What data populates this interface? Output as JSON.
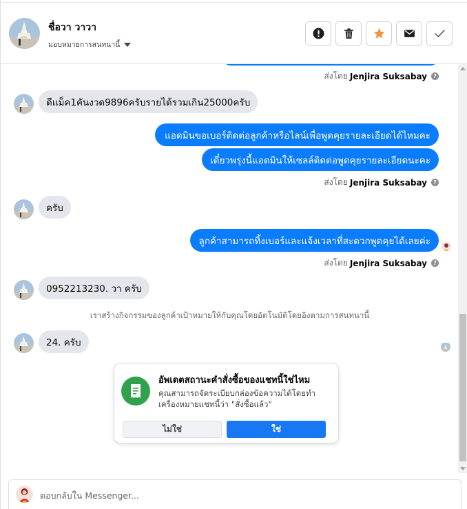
{
  "header": {
    "contact_name": "ชื่อวา วาวา",
    "assign_label": "มอบหมายการสนทนานี้"
  },
  "messages": {
    "sent_by_prefix": "ส่งโดย",
    "sent_by_name": "Jenjira Suksabay",
    "in_1": "ดีแม็ค1คันงวด9896ครับรายได้รวมเกิน25000ครับ",
    "out_1": "แอดมินขอเบอร์ติดต่อลูกค้าหรือไลน์เพื่อพูดคุยรายละเอียดได้ไหมคะ",
    "out_2": "เดี๋ยวพรุ่งนี้แอดมินให้เซลล์ติดต่อพูดคุยรายละเอียดนะคะ",
    "in_2": "ครับ",
    "out_3": "ลูกค้าสามารถทิ้งเบอร์และแจ้งเวลาที่สะดวกพูดคุยได้เลยค่ะ",
    "in_3": "0952213230. วา ครับ",
    "system_note": "เราสร้างกิจกรรมของลูกค้าเป้าหมายให้กับคุณโดยอัตโนมัติโดยอิงตามการสนทนานี้",
    "in_4": "24. ครับ"
  },
  "order_card": {
    "title": "อัพเดตสถานะคำสั่งซื้อของแชทนี้ใช่ไหม",
    "description": "คุณสามารถจัดระเบียบกล่องข้อความได้โดยทำเครื่องหมายแชทนี้ว่า \"สั่งซื้อแล้ว\"",
    "no_label": "ไม่ใช่",
    "yes_label": "ใช่"
  },
  "reply": {
    "placeholder": "ตอบกลับใน Messenger..."
  },
  "icons": {
    "spam": "exclamation-circle-icon",
    "delete": "trash-icon",
    "star": "star-icon",
    "unread": "envelope-icon",
    "done": "checkmark-icon",
    "help": "question-circle-icon",
    "receipt": "receipt-icon"
  },
  "colors": {
    "outgoing_bubble": "#0a7cff",
    "incoming_bubble": "#e4e6eb",
    "star": "#f7923b",
    "receipt_icon_bg": "#31a24c",
    "yes_button": "#1877f2"
  }
}
